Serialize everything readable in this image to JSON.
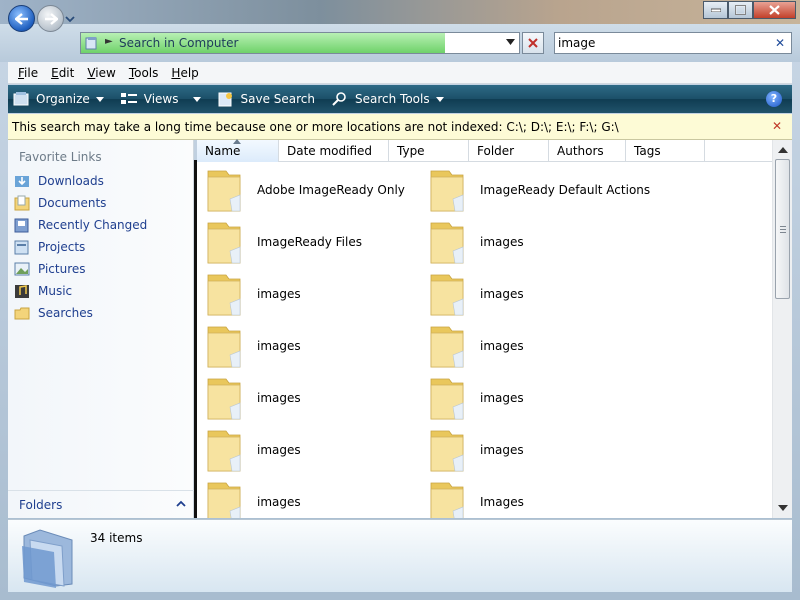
{
  "window": {},
  "address": {
    "location": "Search in Computer",
    "progress": 0.83
  },
  "search": {
    "value": "image"
  },
  "menu": [
    {
      "key": "F",
      "rest": "ile"
    },
    {
      "key": "E",
      "rest": "dit"
    },
    {
      "key": "V",
      "rest": "iew"
    },
    {
      "key": "T",
      "rest": "ools"
    },
    {
      "key": "H",
      "rest": "elp"
    }
  ],
  "toolbar": {
    "organize": "Organize",
    "views": "Views",
    "save_search": "Save Search",
    "search_tools": "Search Tools",
    "help": "?"
  },
  "infobar": {
    "message": "This search may take a long time because one or more locations are not indexed: C:\\; D:\\; E:\\; F:\\; G:\\"
  },
  "nav": {
    "header": "Favorite Links",
    "items": [
      "Downloads",
      "Documents",
      "Recently Changed",
      "Projects",
      "Pictures",
      "Music",
      "Searches"
    ],
    "folders_label": "Folders"
  },
  "columns": [
    "Name",
    "Date modified",
    "Type",
    "Folder",
    "Authors",
    "Tags"
  ],
  "files": [
    "Adobe ImageReady Only",
    "ImageReady Default Actions",
    "ImageReady Files",
    "images",
    "images",
    "images",
    "images",
    "images",
    "images",
    "images",
    "images",
    "images",
    "images",
    "Images"
  ],
  "status": {
    "count": "34 items"
  },
  "colors": {
    "accent": "#1f3f8f",
    "commandbar": "#1b4f68",
    "infobar": "#fdfbd6"
  }
}
